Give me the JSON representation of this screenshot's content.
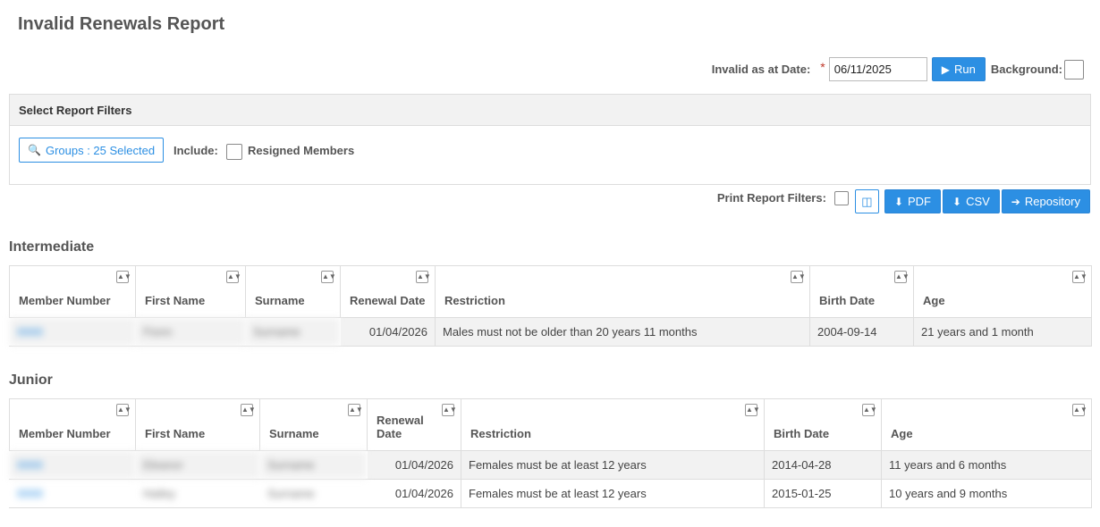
{
  "page": {
    "title": "Invalid Renewals Report"
  },
  "run_bar": {
    "date_label": "Invalid as at Date:",
    "required_mark": "*",
    "date_value": "06/11/2025",
    "run_icon": "play-icon",
    "run_label": "Run",
    "background_label": "Background:"
  },
  "filters": {
    "title": "Select Report Filters",
    "groups_icon": "magnifier-plus-icon",
    "groups_label": "Groups : 25 Selected",
    "include_label": "Include:",
    "resigned_label": "Resigned Members"
  },
  "export_bar": {
    "print_filters_label": "Print Report Filters:",
    "columns_icon": "columns-icon",
    "pdf_label": "PDF",
    "csv_label": "CSV",
    "repository_label": "Repository",
    "download_icon": "download-icon",
    "arrow_icon": "arrow-right-icon"
  },
  "colors": {
    "accent": "#2c8fe3",
    "header_bg": "#f2f2f2",
    "border": "#dddddd"
  },
  "sections": [
    {
      "title": "Intermediate",
      "columns": [
        "Member Number",
        "First Name",
        "Surname",
        "Renewal Date",
        "Restriction",
        "Birth Date",
        "Age"
      ],
      "rows": [
        [
          "0000",
          "Fionn",
          "Surname",
          "01/04/2026",
          "Males must not be older than 20 years 11 months",
          "2004-09-14",
          "21 years and 1 month"
        ]
      ]
    },
    {
      "title": "Junior",
      "columns": [
        "Member Number",
        "First Name",
        "Surname",
        "Renewal Date",
        "Restriction",
        "Birth Date",
        "Age"
      ],
      "rows": [
        [
          "0000",
          "Eleanor",
          "Surname",
          "01/04/2026",
          "Females must be at least 12 years",
          "2014-04-28",
          "11 years and 6 months"
        ],
        [
          "0000",
          "Hailey",
          "Surname",
          "01/04/2026",
          "Females must be at least 12 years",
          "2015-01-25",
          "10 years and 9 months"
        ]
      ]
    }
  ]
}
